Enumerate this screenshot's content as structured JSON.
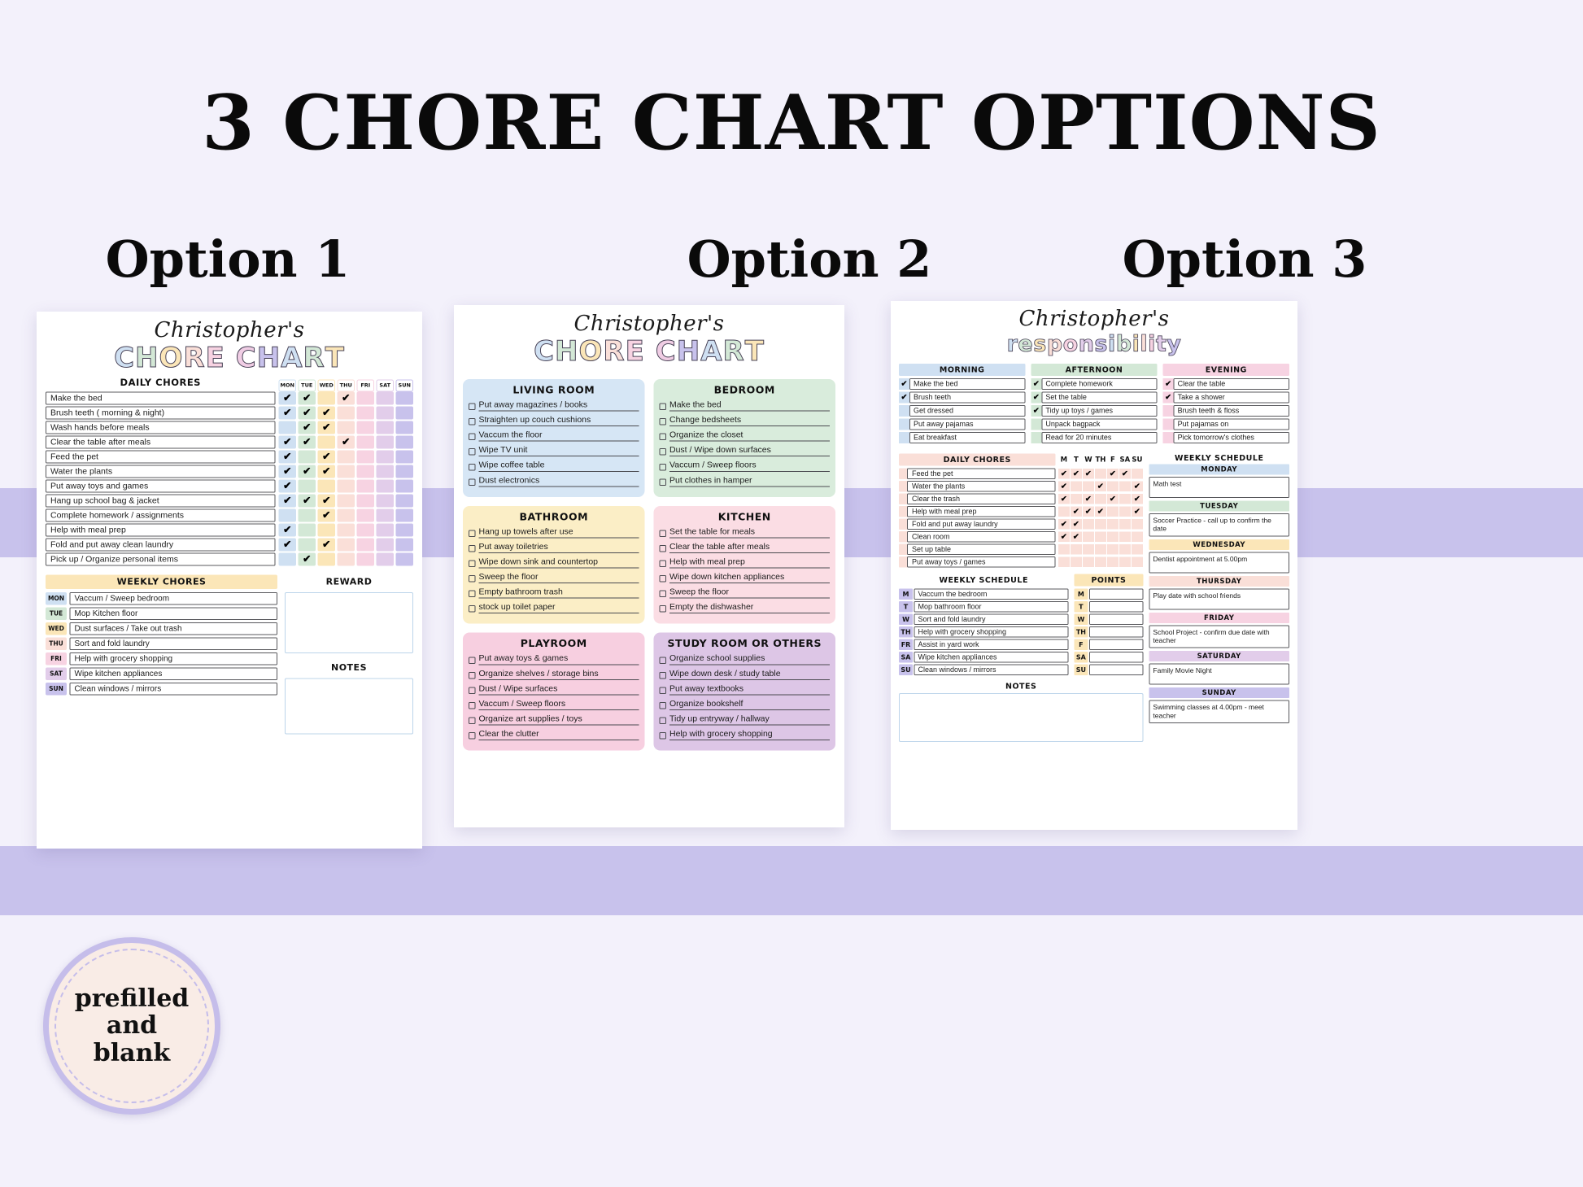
{
  "page": {
    "main_title": "3 CHORE CHART OPTIONS",
    "option_labels": [
      "Option 1",
      "Option 2",
      "Option 3"
    ],
    "badge": {
      "line1": "prefilled",
      "line2": "and",
      "line3": "blank"
    },
    "owner_name": "Christopher's"
  },
  "colors": {
    "background": "#f3f1fb",
    "band": "#c8c2ec",
    "blue": "#cfe0f2",
    "green": "#d3e8d6",
    "yellow": "#fbe6b8",
    "peach": "#fadfd8",
    "pink": "#f7d3e2",
    "mauve": "#e2cdea",
    "purple": "#c8c2ec",
    "card_blue": "#d6e6f5",
    "card_green": "#d9ecdc",
    "card_yellow": "#fbeec6",
    "card_pink": "#fbdde4",
    "card_rose": "#f7cfe0",
    "card_purple": "#ddc6e6"
  },
  "option1": {
    "title_word1": "CHORE",
    "title_word2": "CHART",
    "title_word1_colors": [
      "#cfe0f2",
      "#d3e8d6",
      "#fbe6b8",
      "#fadfd8",
      "#f7d3e2"
    ],
    "title_word2_colors": [
      "#f0cde4",
      "#c8c2ec",
      "#cfe0f2",
      "#d3e8d6",
      "#fbe6b8"
    ],
    "daily_chores_header": "DAILY CHORES",
    "days": [
      "MON",
      "TUE",
      "WED",
      "THU",
      "FRI",
      "SAT",
      "SUN"
    ],
    "day_colors": [
      "#cfe0f2",
      "#d3e8d6",
      "#fbe6b8",
      "#fadfd8",
      "#f7d3e2",
      "#e2cdea",
      "#c8c2ec"
    ],
    "chores": [
      {
        "label": "Make the bed",
        "checks": [
          1,
          1,
          0,
          1,
          0,
          0,
          0
        ]
      },
      {
        "label": "Brush teeth ( morning & night)",
        "checks": [
          1,
          1,
          1,
          0,
          0,
          0,
          0
        ]
      },
      {
        "label": "Wash hands before meals",
        "checks": [
          0,
          1,
          1,
          0,
          0,
          0,
          0
        ]
      },
      {
        "label": "Clear the table after meals",
        "checks": [
          1,
          1,
          0,
          1,
          0,
          0,
          0
        ]
      },
      {
        "label": "Feed the pet",
        "checks": [
          1,
          0,
          1,
          0,
          0,
          0,
          0
        ]
      },
      {
        "label": "Water the plants",
        "checks": [
          1,
          1,
          1,
          0,
          0,
          0,
          0
        ]
      },
      {
        "label": "Put away toys and games",
        "checks": [
          1,
          0,
          0,
          0,
          0,
          0,
          0
        ]
      },
      {
        "label": "Hang up school bag & jacket",
        "checks": [
          1,
          1,
          1,
          0,
          0,
          0,
          0
        ]
      },
      {
        "label": "Complete homework / assignments",
        "checks": [
          0,
          0,
          1,
          0,
          0,
          0,
          0
        ]
      },
      {
        "label": "Help with meal prep",
        "checks": [
          1,
          0,
          0,
          0,
          0,
          0,
          0
        ]
      },
      {
        "label": "Fold and put away clean laundry",
        "checks": [
          1,
          0,
          1,
          0,
          0,
          0,
          0
        ]
      },
      {
        "label": "Pick up / Organize personal items",
        "checks": [
          0,
          1,
          0,
          0,
          0,
          0,
          0
        ]
      }
    ],
    "weekly_header": "WEEKLY CHORES",
    "weekly": [
      {
        "day": "MON",
        "color": "#cfe0f2",
        "task": "Vaccum / Sweep bedroom"
      },
      {
        "day": "TUE",
        "color": "#d3e8d6",
        "task": "Mop Kitchen floor"
      },
      {
        "day": "WED",
        "color": "#fbe6b8",
        "task": "Dust surfaces / Take out trash"
      },
      {
        "day": "THU",
        "color": "#fadfd8",
        "task": "Sort and fold laundry"
      },
      {
        "day": "FRI",
        "color": "#f7d3e2",
        "task": "Help with grocery shopping"
      },
      {
        "day": "SAT",
        "color": "#e2cdea",
        "task": "Wipe kitchen appliances"
      },
      {
        "day": "SUN",
        "color": "#c8c2ec",
        "task": "Clean windows / mirrors"
      }
    ],
    "reward_header": "REWARD",
    "notes_header": "NOTES"
  },
  "option2": {
    "title_word1": "CHORE",
    "title_word2": "CHART",
    "cards": [
      {
        "title": "LIVING ROOM",
        "color": "#d6e6f5",
        "items": [
          "Put away magazines / books",
          "Straighten up couch cushions",
          "Vaccum the floor",
          "Wipe TV unit",
          "Wipe coffee table",
          "Dust electronics"
        ]
      },
      {
        "title": "BEDROOM",
        "color": "#d9ecdc",
        "items": [
          "Make the bed",
          "Change bedsheets",
          "Organize the closet",
          "Dust / Wipe down surfaces",
          "Vaccum / Sweep floors",
          "Put clothes in hamper"
        ]
      },
      {
        "title": "BATHROOM",
        "color": "#fbeec6",
        "items": [
          "Hang up towels after use",
          "Put away toiletries",
          "Wipe down sink and countertop",
          "Sweep the floor",
          "Empty bathroom trash",
          "stock up toilet paper"
        ]
      },
      {
        "title": "KITCHEN",
        "color": "#fbdde4",
        "items": [
          "Set the table for meals",
          "Clear the table after meals",
          "Help with meal prep",
          "Wipe down kitchen appliances",
          "Sweep the floor",
          "Empty the dishwasher"
        ]
      },
      {
        "title": "PLAYROOM",
        "color": "#f7cfe0",
        "items": [
          "Put away toys & games",
          "Organize shelves / storage bins",
          "Dust / Wipe surfaces",
          "Vaccum / Sweep floors",
          "Organize art supplies / toys",
          "Clear the clutter"
        ]
      },
      {
        "title": "STUDY ROOM OR OTHERS",
        "color": "#ddc6e6",
        "items": [
          "Organize school supplies",
          "Wipe down desk / study table",
          "Put away textbooks",
          "Organize bookshelf",
          "Tidy up entryway / hallway",
          "Help with grocery shopping"
        ]
      }
    ]
  },
  "option3": {
    "title_word": "responsibility",
    "time_blocks": [
      {
        "title": "MORNING",
        "color": "#cfe0f2",
        "items": [
          {
            "label": "Make the bed",
            "checked": true
          },
          {
            "label": "Brush teeth",
            "checked": true
          },
          {
            "label": "Get dressed",
            "checked": false
          },
          {
            "label": "Put away pajamas",
            "checked": false
          },
          {
            "label": "Eat breakfast",
            "checked": false
          }
        ]
      },
      {
        "title": "AFTERNOON",
        "color": "#d3e8d6",
        "items": [
          {
            "label": "Complete homework",
            "checked": true
          },
          {
            "label": "Set the table",
            "checked": true
          },
          {
            "label": "Tidy up toys / games",
            "checked": true
          },
          {
            "label": "Unpack bagpack",
            "checked": false
          },
          {
            "label": "Read for 20 minutes",
            "checked": false
          }
        ]
      },
      {
        "title": "EVENING",
        "color": "#f7d3e2",
        "items": [
          {
            "label": "Clear the table",
            "checked": true
          },
          {
            "label": "Take a shower",
            "checked": true
          },
          {
            "label": "Brush teeth & floss",
            "checked": false
          },
          {
            "label": "Put pajamas on",
            "checked": false
          },
          {
            "label": "Pick tomorrow's clothes",
            "checked": false
          }
        ]
      }
    ],
    "daily_chores_header": "DAILY CHORES",
    "day_letters": [
      "M",
      "T",
      "W",
      "TH",
      "F",
      "SA",
      "SU"
    ],
    "daily_chores": [
      {
        "label": "Feed the pet",
        "checks": [
          1,
          1,
          1,
          0,
          1,
          1,
          0
        ]
      },
      {
        "label": "Water the plants",
        "checks": [
          1,
          0,
          0,
          1,
          0,
          0,
          1
        ]
      },
      {
        "label": "Clear the trash",
        "checks": [
          1,
          0,
          1,
          0,
          1,
          0,
          1
        ]
      },
      {
        "label": "Help with meal prep",
        "checks": [
          0,
          1,
          1,
          1,
          0,
          0,
          1
        ]
      },
      {
        "label": "Fold and put away laundry",
        "checks": [
          1,
          1,
          0,
          0,
          0,
          0,
          0
        ]
      },
      {
        "label": "Clean room",
        "checks": [
          1,
          1,
          0,
          0,
          0,
          0,
          0
        ]
      },
      {
        "label": "Set up table",
        "checks": [
          0,
          0,
          0,
          0,
          0,
          0,
          0
        ]
      },
      {
        "label": "Put away toys / games",
        "checks": [
          0,
          0,
          0,
          0,
          0,
          0,
          0
        ]
      }
    ],
    "weekly_schedule_header": "WEEKLY SCHEDULE",
    "points_header": "POINTS",
    "weekly_tasks": [
      {
        "day": "M",
        "pt": "M",
        "task": "Vaccum the bedroom"
      },
      {
        "day": "T",
        "pt": "T",
        "task": "Mop bathroom floor"
      },
      {
        "day": "W",
        "pt": "W",
        "task": "Sort and fold laundry"
      },
      {
        "day": "TH",
        "pt": "TH",
        "task": "Help with grocery shopping"
      },
      {
        "day": "FR",
        "pt": "F",
        "task": "Assist in yard work"
      },
      {
        "day": "SA",
        "pt": "SA",
        "task": "Wipe kitchen appliances"
      },
      {
        "day": "SU",
        "pt": "SU",
        "task": "Clean windows / mirrors"
      }
    ],
    "schedule_header": "WEEKLY SCHEDULE",
    "schedule": [
      {
        "day": "MONDAY",
        "color": "#cfe0f2",
        "note": "Math test"
      },
      {
        "day": "TUESDAY",
        "color": "#d3e8d6",
        "note": "Soccer Practice - call up to confirm the date"
      },
      {
        "day": "WEDNESDAY",
        "color": "#fbe6b8",
        "note": "Dentist appointment at 5.00pm"
      },
      {
        "day": "THURSDAY",
        "color": "#fadfd8",
        "note": "Play date with school friends"
      },
      {
        "day": "FRIDAY",
        "color": "#f7d3e2",
        "note": "School Project - confirm due date with teacher"
      },
      {
        "day": "SATURDAY",
        "color": "#e2cdea",
        "note": "Family Movie Night"
      },
      {
        "day": "SUNDAY",
        "color": "#c8c2ec",
        "note": "Swimming classes at 4.00pm - meet teacher"
      }
    ],
    "notes_header": "NOTES"
  }
}
